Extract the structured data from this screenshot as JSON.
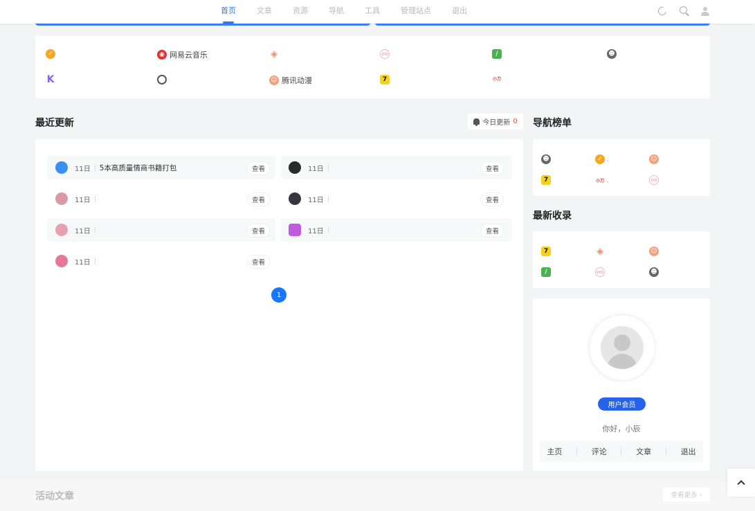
{
  "nav": {
    "items": [
      "首页",
      "文章",
      "资源",
      "导航",
      "工具",
      "管理站点",
      "退出"
    ],
    "active_index": 0
  },
  "sites": [
    {
      "label": "",
      "icon": "badge-check-icon",
      "color": "#f5a623"
    },
    {
      "label": "网易云音乐",
      "icon": "netease-music-icon",
      "color": "#e0312b"
    },
    {
      "label": "",
      "icon": "diamond-target-icon",
      "color": "#f28a6b"
    },
    {
      "label": "",
      "icon": "pig-icon",
      "color": "#f6b6c0"
    },
    {
      "label": "",
      "icon": "leaf-icon",
      "color": "#4caf50"
    },
    {
      "label": "",
      "icon": "character-icon",
      "color": "#444"
    },
    {
      "label": "",
      "icon": "k-logo-icon",
      "color": "#8b5cf6"
    },
    {
      "label": "",
      "icon": "crown-q-icon",
      "color": "#555"
    },
    {
      "label": "腾讯动漫",
      "icon": "tencent-comic-icon",
      "color": "#f3a17a"
    },
    {
      "label": "",
      "icon": "seven-icon",
      "color": "#f7d21d"
    },
    {
      "label": "",
      "icon": "xiaodao-icon",
      "color": "#e53935"
    }
  ],
  "recent": {
    "title": "最近更新",
    "today_label": "今日更新",
    "today_count": "0",
    "view_label": "查看",
    "items": [
      {
        "day": "11日",
        "title": "5本高质量情商书籍打包",
        "avatar_color": "#3b8ff0"
      },
      {
        "day": "11日",
        "title": "",
        "avatar_color": "#2b2b2b"
      },
      {
        "day": "11日",
        "title": "",
        "avatar_color": "#d99aa5"
      },
      {
        "day": "11日",
        "title": "",
        "avatar_color": "#3a3340"
      },
      {
        "day": "11日",
        "title": "",
        "avatar_color": "#e8a0b0"
      },
      {
        "day": "11日",
        "title": "",
        "avatar_color": "#c05be0"
      },
      {
        "day": "11日",
        "title": "",
        "avatar_color": "#e37a9a"
      }
    ],
    "page": "1"
  },
  "nav_rank": {
    "title": "导航榜单",
    "marker": "、"
  },
  "latest": {
    "title": "最新收录"
  },
  "profile": {
    "badge": "用户会员",
    "greeting": "你好，小辰",
    "links": [
      "主页",
      "评论",
      "文章",
      "退出"
    ]
  },
  "active_articles": {
    "title": "活动文章",
    "more": "查看更多 ›"
  },
  "icon_glyphs": {
    "seven": "7",
    "k": "K",
    "xiaodao": "小刀"
  }
}
